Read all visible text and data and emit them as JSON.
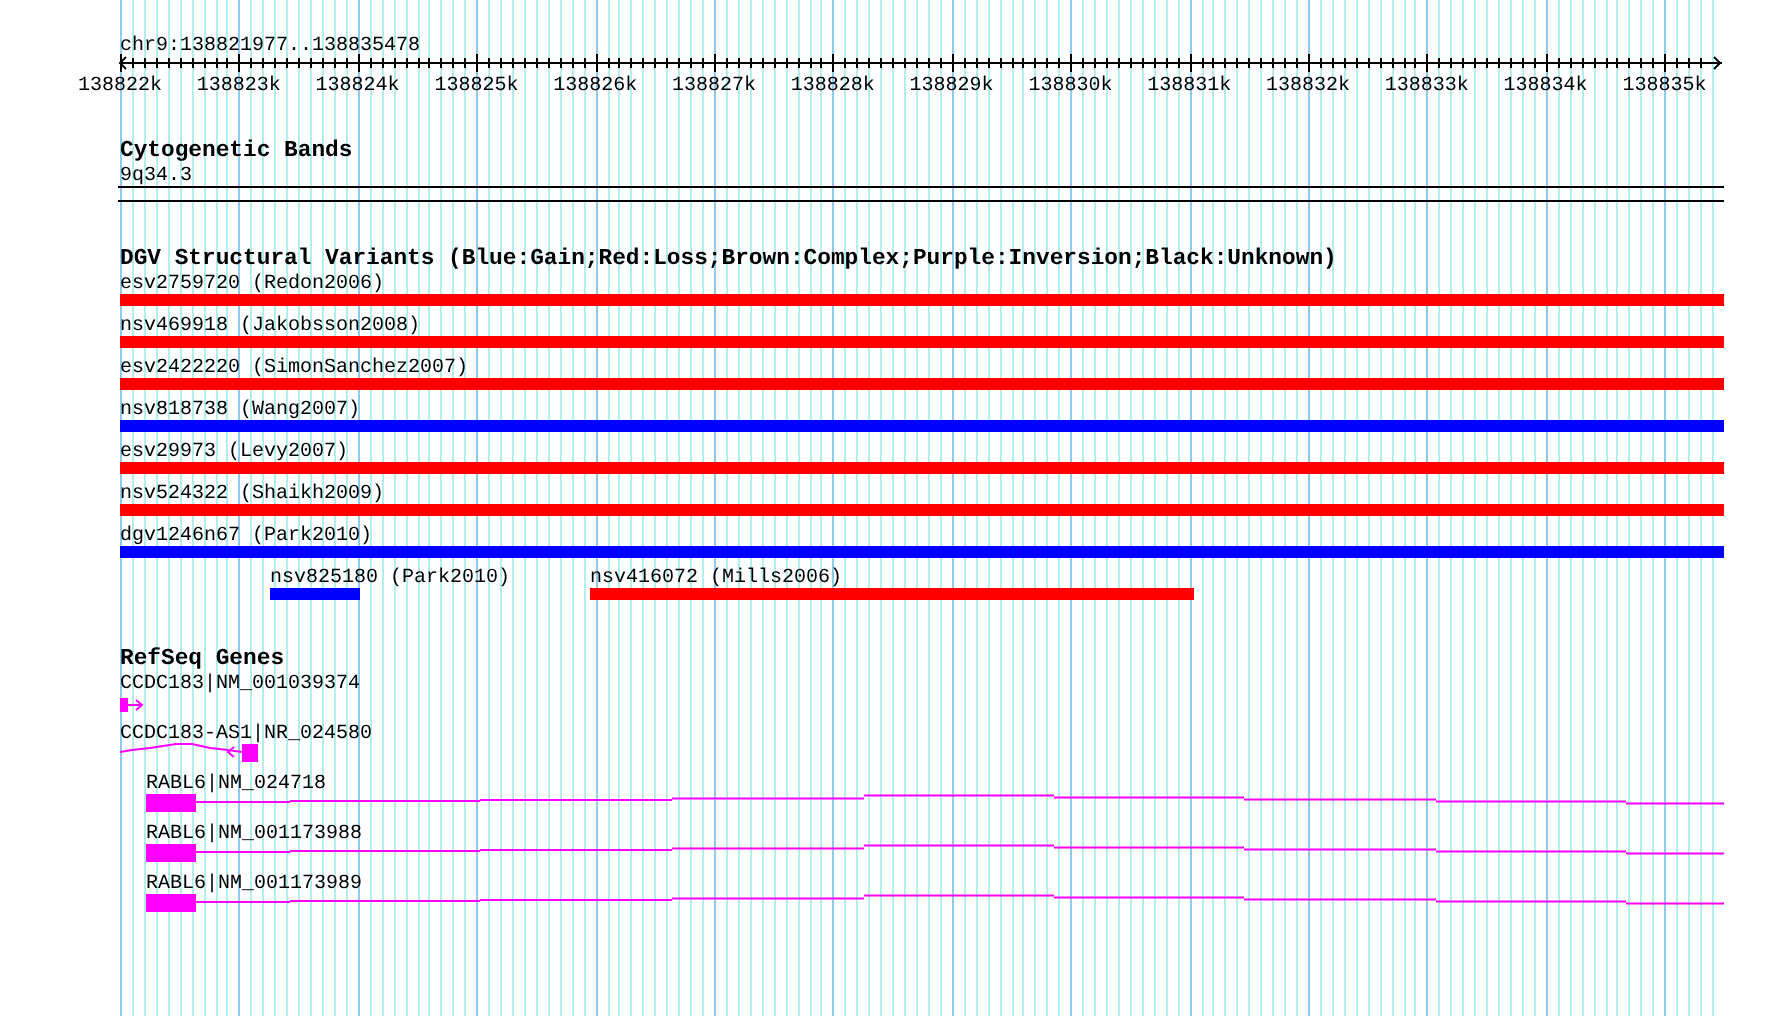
{
  "location": "chr9:138821977..138835478",
  "ruler": {
    "ticks": [
      "138822k",
      "138823k",
      "138824k",
      "138825k",
      "138826k",
      "138827k",
      "138828k",
      "138829k",
      "138830k",
      "138831k",
      "138832k",
      "138833k",
      "138834k",
      "138835k"
    ]
  },
  "cytogenetic_bands": {
    "title": "Cytogenetic Bands",
    "band": "9q34.3"
  },
  "dgv_variants": {
    "title": "DGV Structural Variants (Blue:Gain;Red:Loss;Brown:Complex;Purple:Inversion;Black:Unknown)",
    "rows": [
      {
        "features": [
          {
            "label": "esv2759720 (Redon2006)",
            "color": "#ff0000"
          }
        ]
      },
      {
        "features": [
          {
            "label": "nsv469918 (Jakobsson2008)",
            "color": "#ff0000"
          }
        ]
      },
      {
        "features": [
          {
            "label": "esv2422220 (SimonSanchez2007)",
            "color": "#ff0000"
          }
        ]
      },
      {
        "features": [
          {
            "label": "nsv818738 (Wang2007)",
            "color": "#0000ff"
          }
        ]
      },
      {
        "features": [
          {
            "label": "esv29973 (Levy2007)",
            "color": "#ff0000"
          }
        ]
      },
      {
        "features": [
          {
            "label": "nsv524322 (Shaikh2009)",
            "color": "#ff0000"
          }
        ]
      },
      {
        "features": [
          {
            "label": "dgv1246n67 (Park2010)",
            "color": "#0000ff"
          }
        ]
      },
      {
        "features": [
          {
            "label": "nsv825180 (Park2010)",
            "color": "#0000ff"
          },
          {
            "label": "nsv416072 (Mills2006)",
            "color": "#ff0000"
          }
        ]
      }
    ]
  },
  "refseq_genes": {
    "title": "RefSeq Genes",
    "transcripts": [
      {
        "label": "CCDC183|NM_001039374",
        "kind": "forward"
      },
      {
        "label": "CCDC183-AS1|NR_024580",
        "kind": "reverse"
      },
      {
        "label": "RABL6|NM_024718",
        "kind": "multi"
      },
      {
        "label": "RABL6|NM_001173988",
        "kind": "multi"
      },
      {
        "label": "RABL6|NM_001173989",
        "kind": "multi"
      }
    ]
  }
}
